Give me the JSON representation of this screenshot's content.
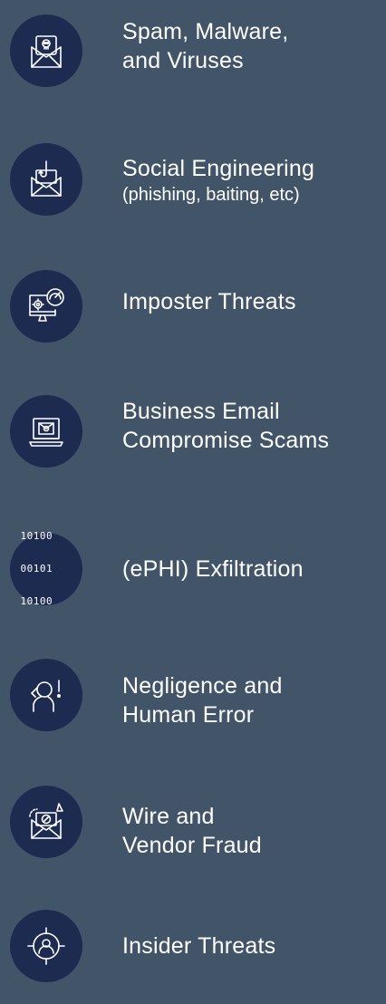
{
  "threats": [
    {
      "icon": "envelope-skull-icon",
      "lines": [
        "Spam, Malware,",
        "and Viruses"
      ]
    },
    {
      "icon": "envelope-phishing-hook-icon",
      "lines": [
        "Social Engineering"
      ],
      "sub": "(phishing, baiting, etc)"
    },
    {
      "icon": "monitor-gear-gauge-icon",
      "lines": [
        "Imposter Threats"
      ]
    },
    {
      "icon": "laptop-email-icon",
      "lines": [
        "Business Email",
        "Compromise Scams"
      ]
    },
    {
      "icon": "binary-code-icon",
      "icon_text": [
        "10100",
        "00101",
        "10100"
      ],
      "lines": [
        "(ePHI) Exfiltration"
      ]
    },
    {
      "icon": "person-alert-icon",
      "lines": [
        "Negligence and",
        "Human Error"
      ]
    },
    {
      "icon": "envelope-block-icon",
      "lines": [
        "Wire and",
        "Vendor Fraud"
      ]
    },
    {
      "icon": "person-target-icon",
      "lines": [
        "Insider Threats"
      ]
    }
  ]
}
